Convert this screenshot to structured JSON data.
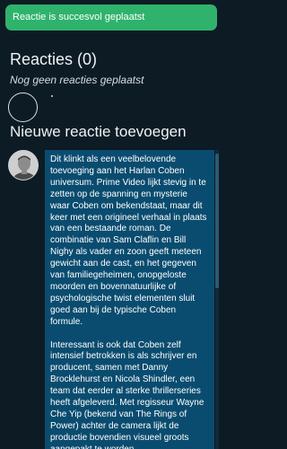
{
  "toast": {
    "message": "Reactie is succesvol geplaatst",
    "color": "#2fb36c"
  },
  "comments": {
    "title": "Reacties (0)",
    "empty_note": "Nog geen reacties geplaatst"
  },
  "new_comment": {
    "title": "Nieuwe reactie toevoegen",
    "text": "Dit klinkt als een veelbelovende toevoeging aan het Harlan Coben universum. Prime Video lijkt stevig in te zetten op de spanning en mysterie waar Coben om bekendstaat, maar dit keer met een origineel verhaal in plaats van een bestaande roman. De combinatie van Sam Claflin en Bill Nighy als vader en zoon geeft meteen gewicht aan de cast, en het gegeven van familiegeheimen, onopgeloste moorden en bovennatuurlijke of psychologische twist elementen sluit goed aan bij de typische Coben formule.\n\nInteressant is ook dat Coben zelf intensief betrokken is als schrijver en producent, samen met Danny Brocklehurst en Nicola Shindler, een team dat eerder al sterke thrillerseries heeft afgeleverd. Met regisseur Wayne Che Yip (bekend van The Rings of Power) achter de camera lijkt de productie bovendien visueel groots aangepakt te worden.",
    "textarea_color": "#0a4c6f"
  },
  "colors": {
    "background": "#0d1b25"
  }
}
